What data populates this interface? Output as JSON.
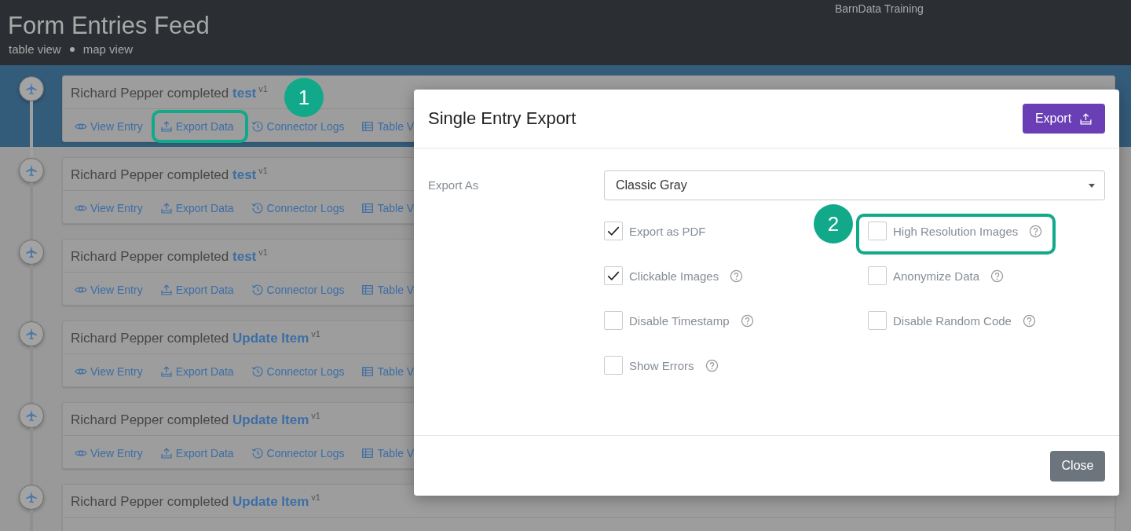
{
  "header": {
    "title": "Form Entries Feed",
    "org": "BarnData Training",
    "views": [
      "table view",
      "map view"
    ]
  },
  "entries": [
    {
      "actor": "Richard Pepper",
      "verb": "completed",
      "form": "test",
      "version": "v1",
      "selected": true,
      "actions": [
        {
          "kind": "view",
          "label": "View Entry"
        },
        {
          "kind": "export",
          "label": "Export Data"
        },
        {
          "kind": "logs",
          "label": "Connector Logs"
        },
        {
          "kind": "table",
          "label": "Table V"
        }
      ]
    },
    {
      "actor": "Richard Pepper",
      "verb": "completed",
      "form": "test",
      "version": "v1",
      "selected": false,
      "actions": [
        {
          "kind": "view",
          "label": "View Entry"
        },
        {
          "kind": "export",
          "label": "Export Data"
        },
        {
          "kind": "logs",
          "label": "Connector Logs"
        },
        {
          "kind": "table",
          "label": "Table V"
        }
      ]
    },
    {
      "actor": "Richard Pepper",
      "verb": "completed",
      "form": "test",
      "version": "v1",
      "selected": false,
      "actions": [
        {
          "kind": "view",
          "label": "View Entry"
        },
        {
          "kind": "export",
          "label": "Export Data"
        },
        {
          "kind": "logs",
          "label": "Connector Logs"
        },
        {
          "kind": "table",
          "label": "Table V"
        }
      ]
    },
    {
      "actor": "Richard Pepper",
      "verb": "completed",
      "form": "Update Item",
      "version": "v1",
      "selected": false,
      "actions": [
        {
          "kind": "view",
          "label": "View Entry"
        },
        {
          "kind": "export",
          "label": "Export Data"
        },
        {
          "kind": "logs",
          "label": "Connector Logs"
        },
        {
          "kind": "table",
          "label": "Table V"
        }
      ]
    },
    {
      "actor": "Richard Pepper",
      "verb": "completed",
      "form": "Update Item",
      "version": "v1",
      "selected": false,
      "actions": [
        {
          "kind": "view",
          "label": "View Entry"
        },
        {
          "kind": "export",
          "label": "Export Data"
        },
        {
          "kind": "logs",
          "label": "Connector Logs"
        },
        {
          "kind": "table",
          "label": "Table V"
        }
      ]
    },
    {
      "actor": "Richard Pepper",
      "verb": "completed",
      "form": "Update Item",
      "version": "v1",
      "selected": false
    }
  ],
  "modal": {
    "title": "Single Entry Export",
    "export_button": "Export",
    "field_label": "Export As",
    "format": "Classic Gray",
    "options": [
      {
        "label": "Export as PDF",
        "checked": true,
        "help": false
      },
      {
        "label": "High Resolution Images",
        "checked": false,
        "help": true
      },
      {
        "label": "Clickable Images",
        "checked": true,
        "help": true
      },
      {
        "label": "Anonymize Data",
        "checked": false,
        "help": true
      },
      {
        "label": "Disable Timestamp",
        "checked": false,
        "help": true
      },
      {
        "label": "Disable Random Code",
        "checked": false,
        "help": true
      },
      {
        "label": "Show Errors",
        "checked": false,
        "help": true
      }
    ],
    "close_button": "Close"
  },
  "callouts": [
    {
      "number": "1"
    },
    {
      "number": "2"
    }
  ]
}
